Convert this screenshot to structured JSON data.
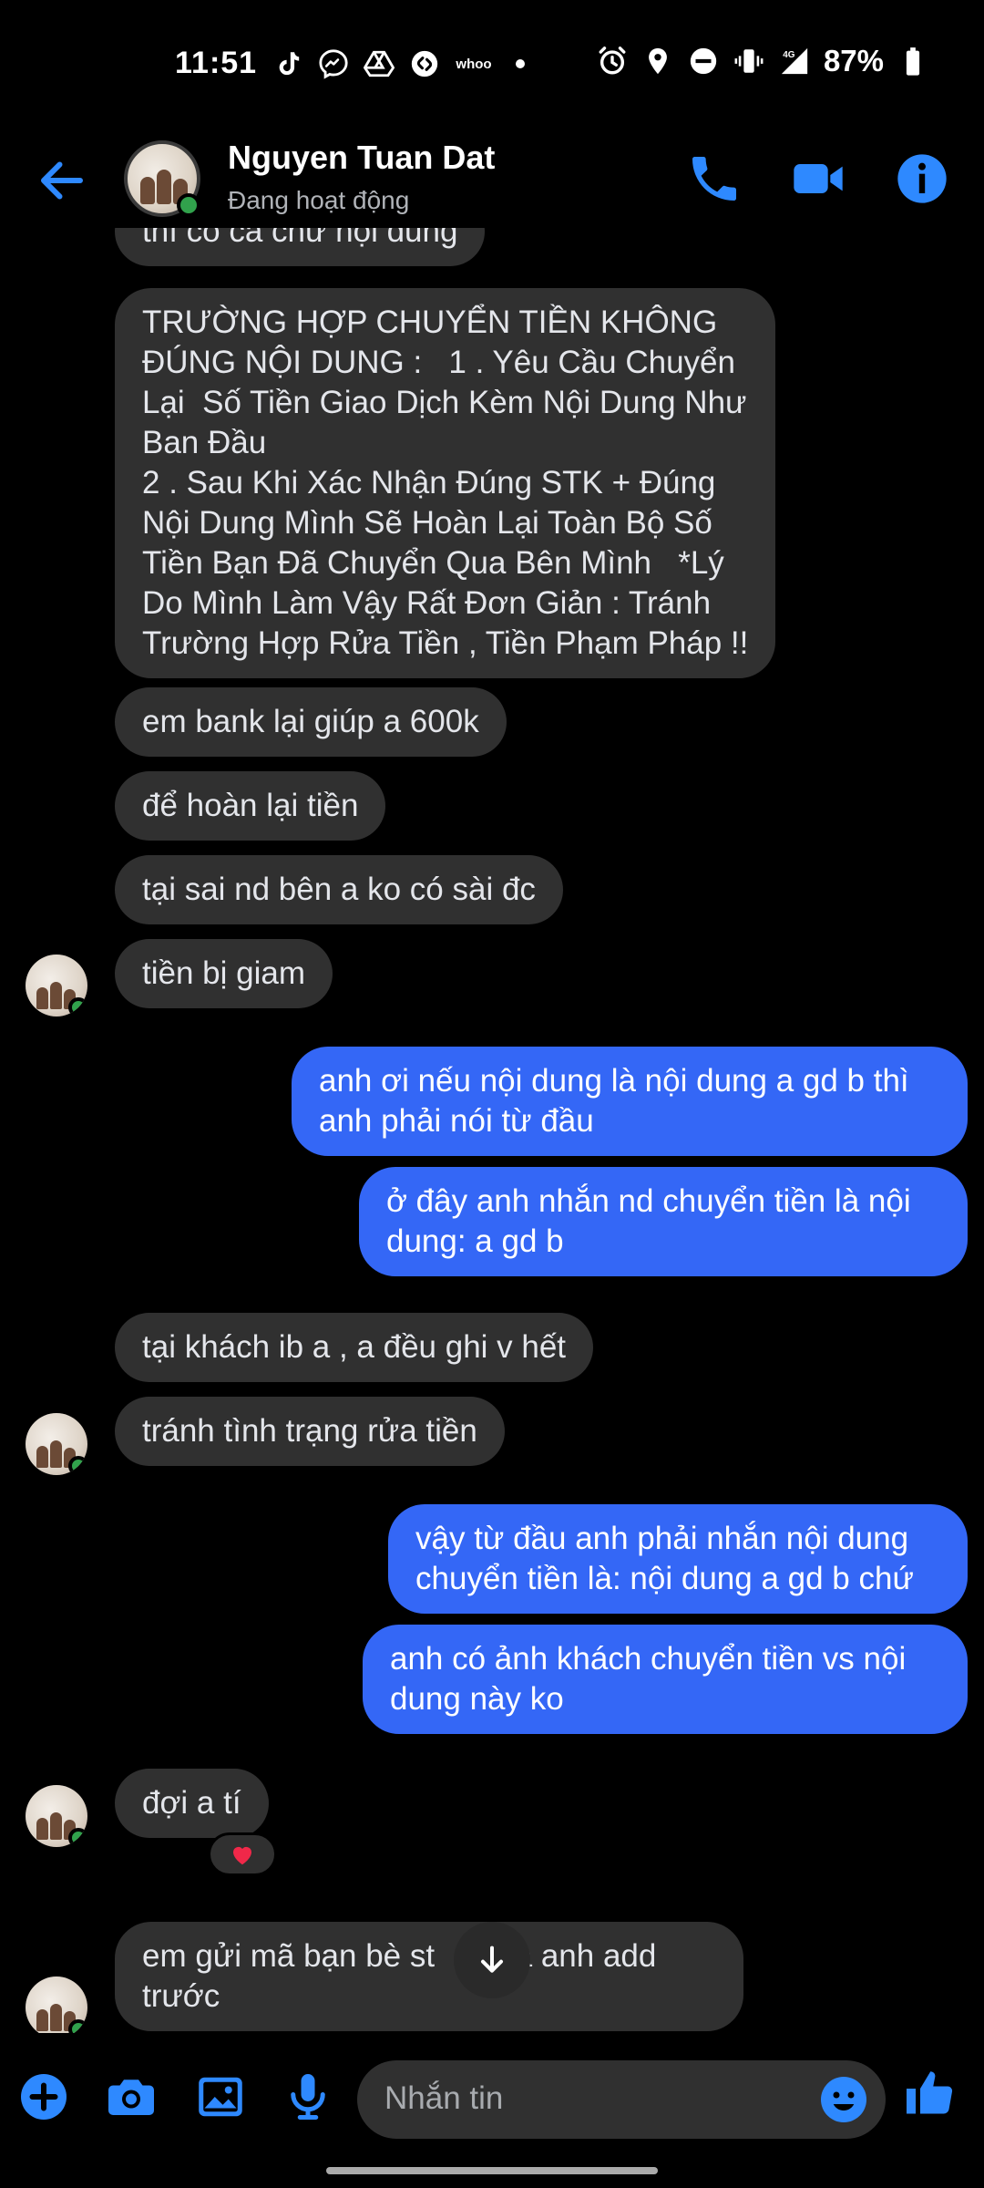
{
  "status_bar": {
    "time": "11:51",
    "whoo_label": "whoo",
    "network": "4G",
    "battery": "87%"
  },
  "header": {
    "contact_name": "Nguyen Tuan Dat",
    "contact_status": "Đang hoạt động",
    "accent_color": "#2e89ff",
    "online_color": "#31a24c"
  },
  "messages": [
    {
      "side": "in",
      "text": "thì có cả chữ nội dung"
    },
    {
      "side": "in",
      "text": "TRƯỜNG HỢP CHUYỂN TIỀN KHÔNG\nĐÚNG NỘI DUNG :   1 . Yêu Cầu Chuyển\nLại  Số Tiền Giao Dịch Kèm Nội Dung Như\nBan Đầu\n2 . Sau Khi Xác Nhận Đúng STK + Đúng\nNội Dung Mình Sẽ Hoàn Lại Toàn Bộ Số\nTiền Bạn Đã Chuyển Qua Bên Mình   *Lý\nDo Mình Làm Vậy Rất Đơn Giản : Tránh\nTrường Hợp Rửa Tiền , Tiền Phạm Pháp !!"
    },
    {
      "side": "in",
      "text": "em bank lại giúp a 600k"
    },
    {
      "side": "in",
      "text": "để hoàn lại tiền"
    },
    {
      "side": "in",
      "text": "tại sai nd bên a ko có sài đc"
    },
    {
      "side": "in",
      "text": "tiền bị giam"
    },
    {
      "side": "out",
      "text": "anh ơi nếu nội dung là nội dung a gd b thì\nanh phải nói từ đầu"
    },
    {
      "side": "out",
      "text": "ở đây anh nhắn nd chuyển tiền là nội\ndung: a gd b"
    },
    {
      "side": "in",
      "text": "tại khách ib a , a đều ghi v hết"
    },
    {
      "side": "in",
      "text": "tránh tình trạng rửa tiền"
    },
    {
      "side": "out",
      "text": "vậy từ đầu anh phải nhắn nội dung\nchuyển tiền là: nội dung a gd b chứ"
    },
    {
      "side": "out",
      "text": "anh có ảnh khách chuyển tiền vs nội\ndung này ko"
    },
    {
      "side": "in",
      "text": "đợi a tí",
      "reaction": "heart"
    },
    {
      "side": "in",
      "text": "em gửi mã bạn bè st     qua anh add\ntrước"
    }
  ],
  "composer": {
    "placeholder": "Nhắn tin"
  },
  "colors": {
    "incoming_bubble": "#303030",
    "outgoing_bubble": "#3467f6",
    "reaction_heart": "#f02849"
  }
}
